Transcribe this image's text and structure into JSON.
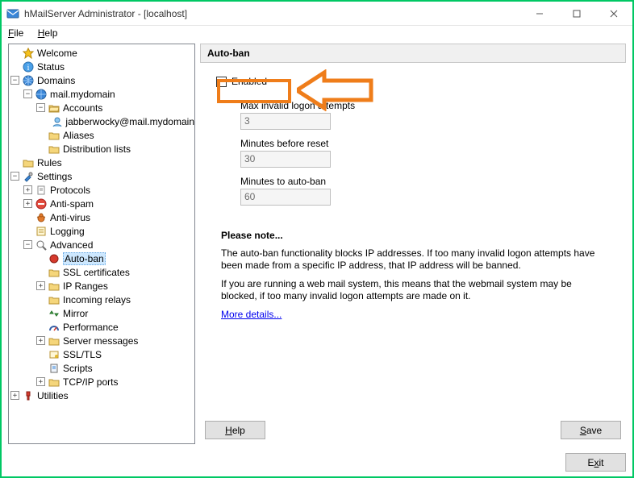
{
  "title": "hMailServer Administrator - [localhost]",
  "menu": {
    "file": "File",
    "help": "Help"
  },
  "tree": {
    "welcome": "Welcome",
    "status": "Status",
    "domains": "Domains",
    "mydomain": "mail.mydomain",
    "accounts": "Accounts",
    "account1": "jabberwocky@mail.mydomain",
    "aliases": "Aliases",
    "dlists": "Distribution lists",
    "rules": "Rules",
    "settings": "Settings",
    "protocols": "Protocols",
    "antispam": "Anti-spam",
    "antivirus": "Anti-virus",
    "logging": "Logging",
    "advanced": "Advanced",
    "autoban": "Auto-ban",
    "sslcerts": "SSL certificates",
    "ipranges": "IP Ranges",
    "increlays": "Incoming relays",
    "mirror": "Mirror",
    "performance": "Performance",
    "servermsg": "Server messages",
    "ssltls": "SSL/TLS",
    "scripts": "Scripts",
    "tcpip": "TCP/IP ports",
    "utilities": "Utilities"
  },
  "panel": {
    "title": "Auto-ban",
    "enabled": "Enabled",
    "f1label": "Max invalid logon attempts",
    "f1val": "3",
    "f2label": "Minutes before reset",
    "f2val": "30",
    "f3label": "Minutes to auto-ban",
    "f3val": "60",
    "noteHead": "Please note...",
    "note1": "The auto-ban functionality blocks IP addresses. If too many invalid logon attempts have been made from a specific IP address, that IP address will be banned.",
    "note2": "If you are running a web mail system, this means that the webmail system may be blocked, if too many invalid logon attempts are made on it.",
    "more": "More details...",
    "help": "Help",
    "save": "Save"
  },
  "footer": {
    "exit": "Exit"
  }
}
